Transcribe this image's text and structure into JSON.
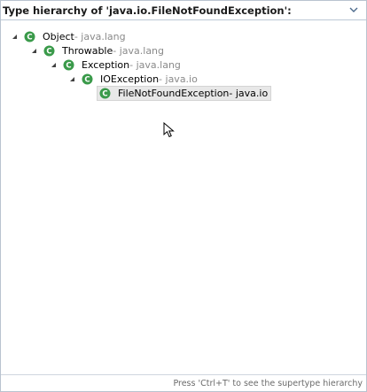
{
  "header": {
    "title": "Type hierarchy of 'java.io.FileNotFoundException':"
  },
  "tree": {
    "nodes": [
      {
        "name": "Object",
        "package": " - java.lang",
        "icon": "class-icon",
        "level": 0
      },
      {
        "name": "Throwable",
        "package": " - java.lang",
        "icon": "class-icon",
        "level": 1
      },
      {
        "name": "Exception",
        "package": " - java.lang",
        "icon": "class-icon",
        "level": 2
      },
      {
        "name": "IOException",
        "package": " - java.io",
        "icon": "class-icon",
        "level": 3
      },
      {
        "name": "FileNotFoundException",
        "package": " - java.io",
        "icon": "class-icon",
        "level": 4,
        "selected": true
      }
    ]
  },
  "status": {
    "text": "Press 'Ctrl+T' to see the supertype hierarchy"
  },
  "colors": {
    "class_icon": "#3a9a4a",
    "selection_bg": "#e8e8e8",
    "package_text": "#8a8a8a"
  }
}
